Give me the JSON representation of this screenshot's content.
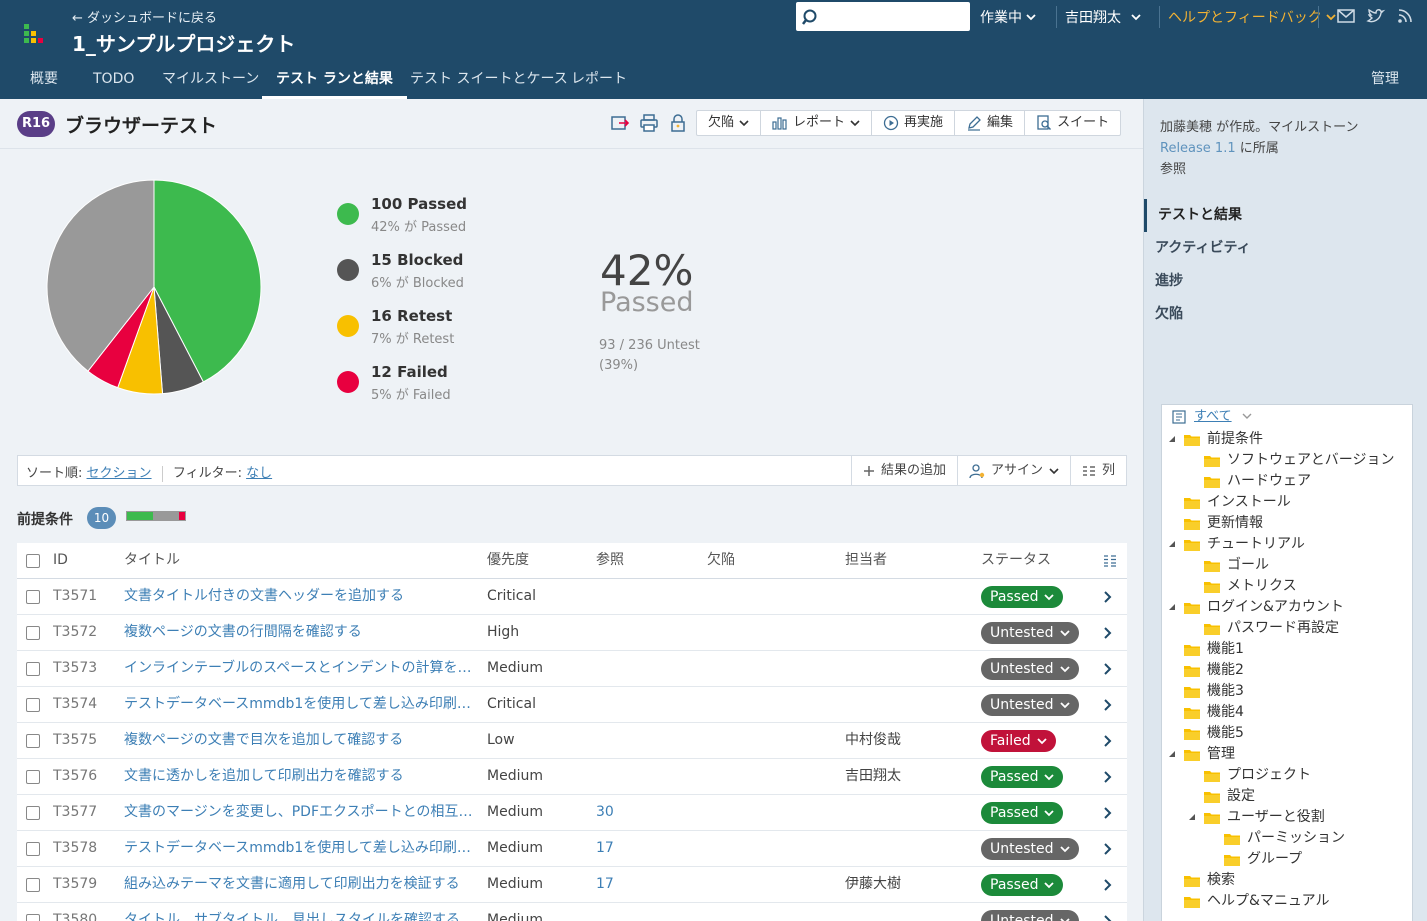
{
  "header": {
    "back_label": "← ダッシュボードに戻る",
    "project_name": "1_サンプルプロジェクト",
    "search_placeholder": "",
    "status_menu": "作業中",
    "user_menu": "吉田翔太",
    "help_menu": "ヘルプとフィードバック"
  },
  "tabs": [
    "概要",
    "TODO",
    "マイルストーン",
    "テスト ランと結果",
    "テスト スイートとケース",
    "レポート"
  ],
  "admin_tab": "管理",
  "run": {
    "badge": "R16",
    "title": "ブラウザーテスト",
    "buttons": [
      "欠陥",
      "レポート",
      "再実施",
      "編集",
      "スイート"
    ]
  },
  "summary": {
    "legend": [
      {
        "main": "100 Passed",
        "sub": "42% が Passed",
        "color": "#3dba4e"
      },
      {
        "main": "15 Blocked",
        "sub": "6% が Blocked",
        "color": "#555555"
      },
      {
        "main": "16 Retest",
        "sub": "7% が Retest",
        "color": "#f8c000"
      },
      {
        "main": "12 Failed",
        "sub": "5% が Failed",
        "color": "#e8003f"
      }
    ],
    "percent": "42%",
    "percent_label": "Passed",
    "untested_line1": "93 / 236 Untest",
    "untested_line2": "(39%)"
  },
  "chart_data": {
    "type": "pie",
    "categories": [
      "Passed",
      "Blocked",
      "Retest",
      "Failed",
      "Untested"
    ],
    "values": [
      100,
      15,
      16,
      12,
      93
    ],
    "colors": [
      "#3dba4e",
      "#555555",
      "#f8c000",
      "#e8003f",
      "#999999"
    ]
  },
  "filterbar": {
    "sort_label": "ソート順:",
    "sort_value": "セクション",
    "filter_label": "フィルター:",
    "filter_value": "なし",
    "add_result": "結果の追加",
    "assign": "アサイン",
    "columns": "列"
  },
  "section": {
    "title": "前提条件",
    "count": "10",
    "progress": {
      "passed": 0.45,
      "untested": 0.45,
      "failed": 0.1
    }
  },
  "table": {
    "headers": {
      "id": "ID",
      "title": "タイトル",
      "priority": "優先度",
      "refs": "参照",
      "defects": "欠陥",
      "assignee": "担当者",
      "status": "ステータス"
    },
    "rows": [
      {
        "id": "T3571",
        "title": "文書タイトル付きの文書ヘッダーを追加する",
        "priority": "Critical",
        "refs": "",
        "assignee": "",
        "status": "Passed"
      },
      {
        "id": "T3572",
        "title": "複数ページの文書の行間隔を確認する",
        "priority": "High",
        "refs": "",
        "assignee": "",
        "status": "Untested"
      },
      {
        "id": "T3573",
        "title": "インラインテーブルのスペースとインデントの計算を確認する",
        "priority": "Medium",
        "refs": "",
        "assignee": "",
        "status": "Untested"
      },
      {
        "id": "T3574",
        "title": "テストデータベースmmdb1を使用して差し込み印刷機能...",
        "priority": "Critical",
        "refs": "",
        "assignee": "",
        "status": "Untested"
      },
      {
        "id": "T3575",
        "title": "複数ページの文書で目次を追加して確認する",
        "priority": "Low",
        "refs": "",
        "assignee": "中村俊哉",
        "status": "Failed"
      },
      {
        "id": "T3576",
        "title": "文書に透かしを追加して印刷出力を確認する",
        "priority": "Medium",
        "refs": "",
        "assignee": "吉田翔太",
        "status": "Passed"
      },
      {
        "id": "T3577",
        "title": "文書のマージンを変更し、PDFエクスポートとの相互運...",
        "priority": "Medium",
        "refs": "30",
        "assignee": "",
        "status": "Passed"
      },
      {
        "id": "T3578",
        "title": "テストデータベースmmdb1を使用して差し込み印刷機能...",
        "priority": "Medium",
        "refs": "17",
        "assignee": "",
        "status": "Untested"
      },
      {
        "id": "T3579",
        "title": "組み込みテーマを文書に適用して印刷出力を検証する",
        "priority": "Medium",
        "refs": "17",
        "assignee": "伊藤大樹",
        "status": "Passed"
      },
      {
        "id": "T3580",
        "title": "タイトル、サブタイトル、見出しスタイルを確認する",
        "priority": "Medium",
        "refs": "",
        "assignee": "",
        "status": "Untested"
      }
    ]
  },
  "sidebar": {
    "info_line1": "加藤美穂 が作成。マイルストーン",
    "milestone_link": "Release 1.1",
    "info_line2_suffix": " に所属",
    "info_line3": "参照",
    "nav": [
      "テストと結果",
      "アクティビティ",
      "進捗",
      "欠陥"
    ],
    "tree_all": "すべて",
    "tree": [
      {
        "label": "前提条件",
        "level": 0,
        "expanded": true
      },
      {
        "label": "ソフトウェアとバージョン",
        "level": 1
      },
      {
        "label": "ハードウェア",
        "level": 1
      },
      {
        "label": "インストール",
        "level": 0
      },
      {
        "label": "更新情報",
        "level": 0
      },
      {
        "label": "チュートリアル",
        "level": 0,
        "expanded": true
      },
      {
        "label": "ゴール",
        "level": 1
      },
      {
        "label": "メトリクス",
        "level": 1
      },
      {
        "label": "ログイン&アカウント",
        "level": 0,
        "expanded": true
      },
      {
        "label": "パスワード再設定",
        "level": 1
      },
      {
        "label": "機能1",
        "level": 0
      },
      {
        "label": "機能2",
        "level": 0
      },
      {
        "label": "機能3",
        "level": 0
      },
      {
        "label": "機能4",
        "level": 0
      },
      {
        "label": "機能5",
        "level": 0
      },
      {
        "label": "管理",
        "level": 0,
        "expanded": true
      },
      {
        "label": "プロジェクト",
        "level": 1
      },
      {
        "label": "設定",
        "level": 1
      },
      {
        "label": "ユーザーと役割",
        "level": 1,
        "expanded": true
      },
      {
        "label": "パーミッション",
        "level": 2
      },
      {
        "label": "グループ",
        "level": 2
      },
      {
        "label": "検索",
        "level": 0
      },
      {
        "label": "ヘルプ&マニュアル",
        "level": 0
      }
    ]
  }
}
